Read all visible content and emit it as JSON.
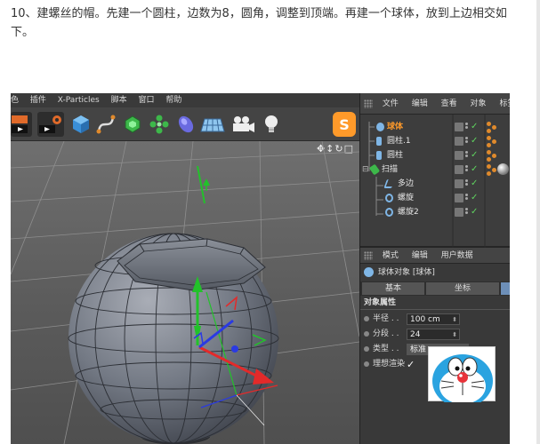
{
  "article": {
    "paragraph": "10、建螺丝的帽。先建一个圆柱，边数为8，圆角，调整到顶端。再建一个球体，放到上边相交如下。"
  },
  "app": {
    "menubar": [
      "色",
      "插件",
      "X-Particles",
      "脚本",
      "窗口",
      "帮助"
    ],
    "toolbar_icons": [
      "render-region-icon",
      "render-settings-icon",
      "cube-icon",
      "spline-pen-icon",
      "nurbs-icon",
      "array-icon",
      "deformer-icon",
      "floor-plane-icon",
      "camera-icon",
      "light-bulb-icon"
    ],
    "viewport_nav": "✥↕↻□",
    "script_badge": "S",
    "object_manager": {
      "menu": [
        "文件",
        "编辑",
        "查看",
        "对象",
        "标签"
      ],
      "objects": [
        {
          "name": "球体",
          "selected": true,
          "icon": "sphere-icon",
          "indent": 1
        },
        {
          "name": "圆柱.1",
          "selected": false,
          "icon": "cylinder-icon",
          "indent": 1
        },
        {
          "name": "圆柱",
          "selected": false,
          "icon": "cylinder-icon",
          "indent": 1
        },
        {
          "name": "扫描",
          "selected": false,
          "icon": "sweep-icon",
          "indent": 0
        },
        {
          "name": "多边",
          "selected": false,
          "icon": "polygon-spline-icon",
          "indent": 2
        },
        {
          "name": "螺旋",
          "selected": false,
          "icon": "helix-icon",
          "indent": 2
        },
        {
          "name": "螺旋2",
          "selected": false,
          "icon": "helix-icon",
          "indent": 2
        }
      ]
    },
    "attribute_manager": {
      "menu": [
        "模式",
        "编辑",
        "用户数据"
      ],
      "object_title": "球体对象 [球体]",
      "tabs": [
        "基本",
        "坐标"
      ],
      "section": "对象属性",
      "properties": [
        {
          "label": "半径 . .",
          "value": "100 cm"
        },
        {
          "label": "分段 . .",
          "value": "24"
        },
        {
          "label": "类型 . .",
          "value": "标准"
        },
        {
          "label": "理想渲染",
          "value": "✓"
        }
      ]
    },
    "colors": {
      "selected_object": "#ff9a2a",
      "object_text": "#e6e6e6",
      "checkmark": "#5fd35f",
      "axis_y": "#22c22a",
      "axis_x": "#e32a2a",
      "axis_z": "#2a3ae3"
    }
  }
}
